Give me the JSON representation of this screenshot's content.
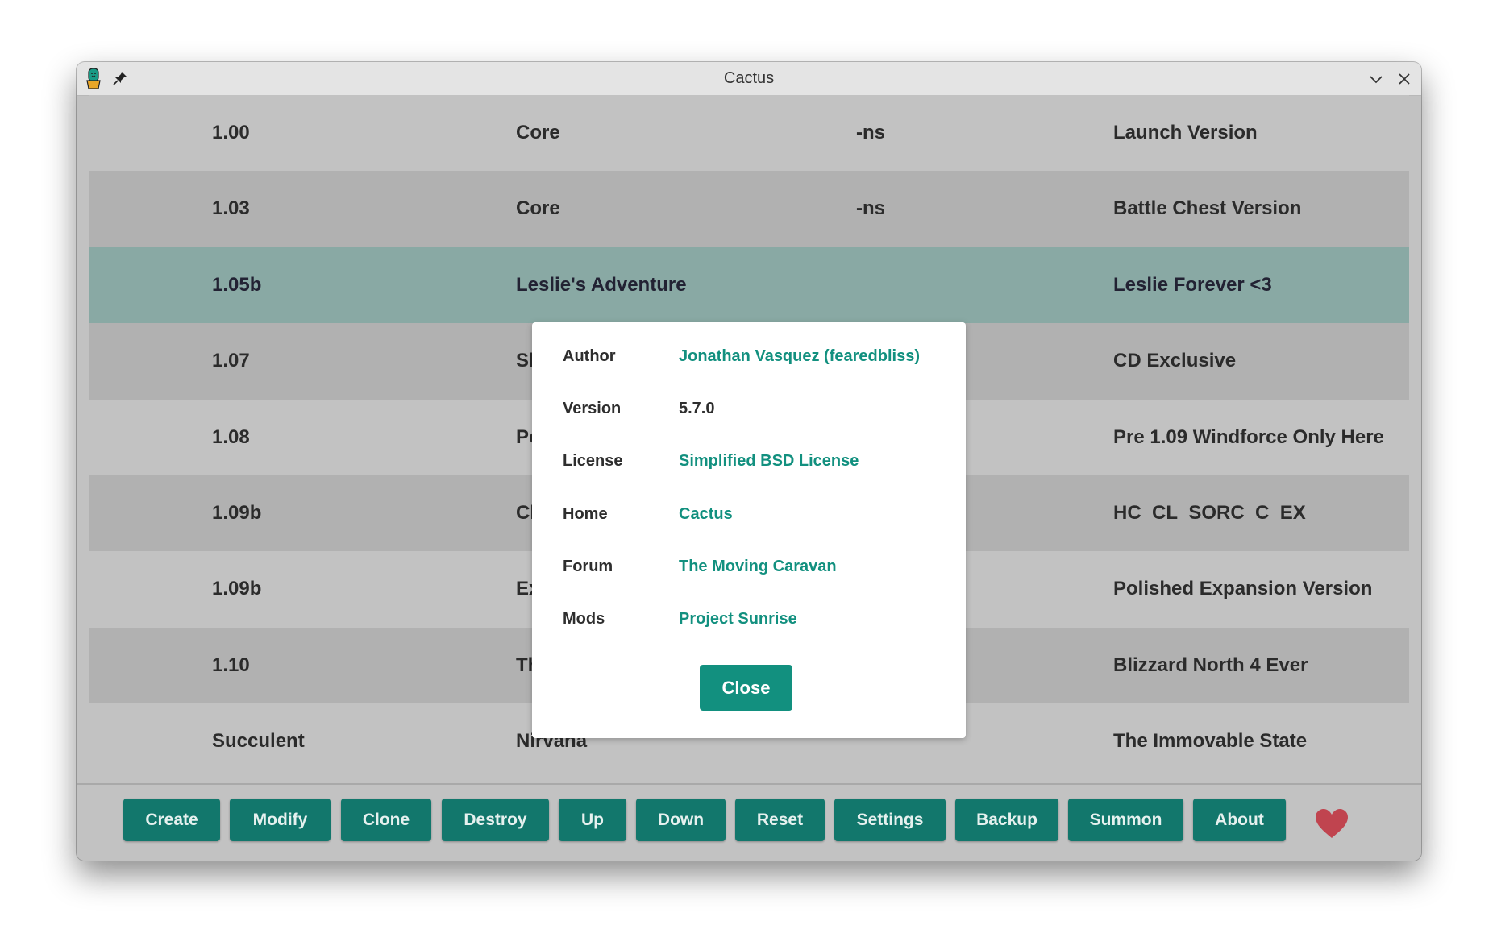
{
  "window": {
    "title": "Cactus"
  },
  "rows": [
    {
      "version": "1.00",
      "type": "Core",
      "flags": "-ns",
      "description": "Launch Version"
    },
    {
      "version": "1.03",
      "type": "Core",
      "flags": "-ns",
      "description": "Battle Chest Version"
    },
    {
      "version": "1.05b",
      "type": "Leslie's Adventure",
      "flags": "",
      "description": "Leslie Forever <3",
      "selected": true
    },
    {
      "version": "1.07",
      "type": "Sl",
      "flags": "",
      "description": "CD Exclusive"
    },
    {
      "version": "1.08",
      "type": "Po",
      "flags": "",
      "description": "Pre 1.09 Windforce Only Here"
    },
    {
      "version": "1.09b",
      "type": "Cl",
      "flags": "",
      "description": "HC_CL_SORC_C_EX"
    },
    {
      "version": "1.09b",
      "type": "Ex",
      "flags": "",
      "description": "Polished Expansion Version"
    },
    {
      "version": "1.10",
      "type": "Th",
      "flags": "",
      "description": "Blizzard North 4 Ever"
    },
    {
      "version": "Succulent",
      "type": "Nirvana",
      "flags": "",
      "description": "The Immovable State"
    }
  ],
  "toolbar": {
    "buttons": [
      "Create",
      "Modify",
      "Clone",
      "Destroy",
      "Up",
      "Down",
      "Reset",
      "Settings",
      "Backup",
      "Summon",
      "About"
    ],
    "heart_color": "#c0444f"
  },
  "about_dialog": {
    "fields": [
      {
        "label": "Author",
        "value": "Jonathan Vasquez (fearedbliss)",
        "link": true
      },
      {
        "label": "Version",
        "value": "5.7.0",
        "link": false
      },
      {
        "label": "License",
        "value": "Simplified BSD License",
        "link": true
      },
      {
        "label": "Home",
        "value": "Cactus",
        "link": true
      },
      {
        "label": "Forum",
        "value": "The Moving Caravan",
        "link": true
      },
      {
        "label": "Mods",
        "value": "Project Sunrise",
        "link": true
      }
    ],
    "close_label": "Close"
  },
  "colors": {
    "accent": "#12776c",
    "link": "#12907f",
    "selected_row": "#89a9a4"
  }
}
